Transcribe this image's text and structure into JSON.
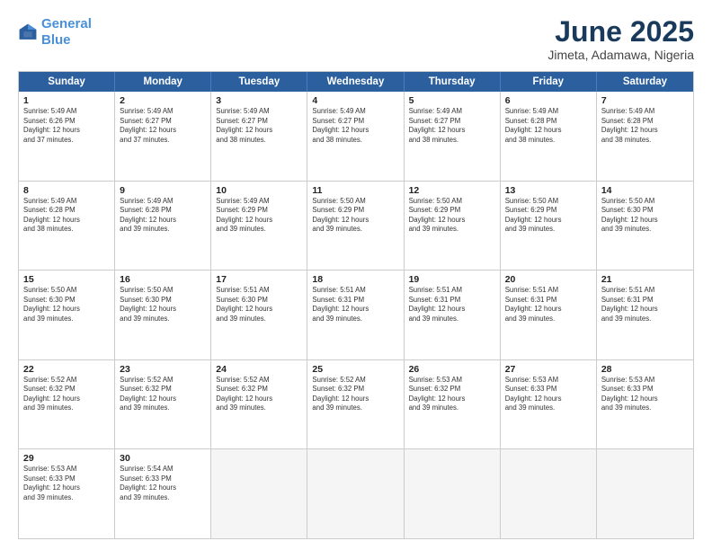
{
  "header": {
    "logo_line1": "General",
    "logo_line2": "Blue",
    "month_title": "June 2025",
    "location": "Jimeta, Adamawa, Nigeria"
  },
  "weekdays": [
    "Sunday",
    "Monday",
    "Tuesday",
    "Wednesday",
    "Thursday",
    "Friday",
    "Saturday"
  ],
  "rows": [
    [
      {
        "day": "1",
        "info": "Sunrise: 5:49 AM\nSunset: 6:26 PM\nDaylight: 12 hours\nand 37 minutes."
      },
      {
        "day": "2",
        "info": "Sunrise: 5:49 AM\nSunset: 6:27 PM\nDaylight: 12 hours\nand 37 minutes."
      },
      {
        "day": "3",
        "info": "Sunrise: 5:49 AM\nSunset: 6:27 PM\nDaylight: 12 hours\nand 38 minutes."
      },
      {
        "day": "4",
        "info": "Sunrise: 5:49 AM\nSunset: 6:27 PM\nDaylight: 12 hours\nand 38 minutes."
      },
      {
        "day": "5",
        "info": "Sunrise: 5:49 AM\nSunset: 6:27 PM\nDaylight: 12 hours\nand 38 minutes."
      },
      {
        "day": "6",
        "info": "Sunrise: 5:49 AM\nSunset: 6:28 PM\nDaylight: 12 hours\nand 38 minutes."
      },
      {
        "day": "7",
        "info": "Sunrise: 5:49 AM\nSunset: 6:28 PM\nDaylight: 12 hours\nand 38 minutes."
      }
    ],
    [
      {
        "day": "8",
        "info": "Sunrise: 5:49 AM\nSunset: 6:28 PM\nDaylight: 12 hours\nand 38 minutes."
      },
      {
        "day": "9",
        "info": "Sunrise: 5:49 AM\nSunset: 6:28 PM\nDaylight: 12 hours\nand 39 minutes."
      },
      {
        "day": "10",
        "info": "Sunrise: 5:49 AM\nSunset: 6:29 PM\nDaylight: 12 hours\nand 39 minutes."
      },
      {
        "day": "11",
        "info": "Sunrise: 5:50 AM\nSunset: 6:29 PM\nDaylight: 12 hours\nand 39 minutes."
      },
      {
        "day": "12",
        "info": "Sunrise: 5:50 AM\nSunset: 6:29 PM\nDaylight: 12 hours\nand 39 minutes."
      },
      {
        "day": "13",
        "info": "Sunrise: 5:50 AM\nSunset: 6:29 PM\nDaylight: 12 hours\nand 39 minutes."
      },
      {
        "day": "14",
        "info": "Sunrise: 5:50 AM\nSunset: 6:30 PM\nDaylight: 12 hours\nand 39 minutes."
      }
    ],
    [
      {
        "day": "15",
        "info": "Sunrise: 5:50 AM\nSunset: 6:30 PM\nDaylight: 12 hours\nand 39 minutes."
      },
      {
        "day": "16",
        "info": "Sunrise: 5:50 AM\nSunset: 6:30 PM\nDaylight: 12 hours\nand 39 minutes."
      },
      {
        "day": "17",
        "info": "Sunrise: 5:51 AM\nSunset: 6:30 PM\nDaylight: 12 hours\nand 39 minutes."
      },
      {
        "day": "18",
        "info": "Sunrise: 5:51 AM\nSunset: 6:31 PM\nDaylight: 12 hours\nand 39 minutes."
      },
      {
        "day": "19",
        "info": "Sunrise: 5:51 AM\nSunset: 6:31 PM\nDaylight: 12 hours\nand 39 minutes."
      },
      {
        "day": "20",
        "info": "Sunrise: 5:51 AM\nSunset: 6:31 PM\nDaylight: 12 hours\nand 39 minutes."
      },
      {
        "day": "21",
        "info": "Sunrise: 5:51 AM\nSunset: 6:31 PM\nDaylight: 12 hours\nand 39 minutes."
      }
    ],
    [
      {
        "day": "22",
        "info": "Sunrise: 5:52 AM\nSunset: 6:32 PM\nDaylight: 12 hours\nand 39 minutes."
      },
      {
        "day": "23",
        "info": "Sunrise: 5:52 AM\nSunset: 6:32 PM\nDaylight: 12 hours\nand 39 minutes."
      },
      {
        "day": "24",
        "info": "Sunrise: 5:52 AM\nSunset: 6:32 PM\nDaylight: 12 hours\nand 39 minutes."
      },
      {
        "day": "25",
        "info": "Sunrise: 5:52 AM\nSunset: 6:32 PM\nDaylight: 12 hours\nand 39 minutes."
      },
      {
        "day": "26",
        "info": "Sunrise: 5:53 AM\nSunset: 6:32 PM\nDaylight: 12 hours\nand 39 minutes."
      },
      {
        "day": "27",
        "info": "Sunrise: 5:53 AM\nSunset: 6:33 PM\nDaylight: 12 hours\nand 39 minutes."
      },
      {
        "day": "28",
        "info": "Sunrise: 5:53 AM\nSunset: 6:33 PM\nDaylight: 12 hours\nand 39 minutes."
      }
    ],
    [
      {
        "day": "29",
        "info": "Sunrise: 5:53 AM\nSunset: 6:33 PM\nDaylight: 12 hours\nand 39 minutes."
      },
      {
        "day": "30",
        "info": "Sunrise: 5:54 AM\nSunset: 6:33 PM\nDaylight: 12 hours\nand 39 minutes."
      },
      {
        "day": "",
        "info": ""
      },
      {
        "day": "",
        "info": ""
      },
      {
        "day": "",
        "info": ""
      },
      {
        "day": "",
        "info": ""
      },
      {
        "day": "",
        "info": ""
      }
    ]
  ]
}
